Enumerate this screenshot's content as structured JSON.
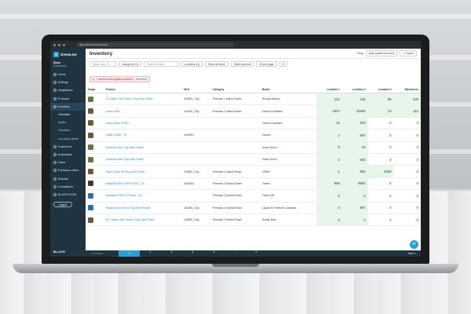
{
  "browser": {
    "url": "app.blaze.me/inventory"
  },
  "sidebar": {
    "brand": "GreenLine",
    "store_name": "Store",
    "store_sub": "Downtown",
    "items": [
      {
        "label": "Home",
        "icon": "home-icon"
      },
      {
        "label": "Settings",
        "icon": "gear-icon"
      },
      {
        "label": "Integrations",
        "icon": "plug-icon"
      },
      {
        "label": "Products",
        "icon": "box-icon"
      },
      {
        "label": "Inventory",
        "icon": "boxes-icon"
      }
    ],
    "subitems": [
      "Overview",
      "Audits",
      "Transfers",
      "Low stock alerts"
    ],
    "items2": [
      {
        "label": "Customers",
        "icon": "users-icon"
      },
      {
        "label": "Employees",
        "icon": "badge-icon"
      },
      {
        "label": "Sales",
        "icon": "cart-icon"
      },
      {
        "label": "Purchase orders",
        "icon": "clipboard-icon"
      },
      {
        "label": "Reports",
        "icon": "chart-icon"
      },
      {
        "label": "Compliance",
        "icon": "shield-icon"
      },
      {
        "label": "BLAZE ECOM",
        "icon": "globe-icon"
      }
    ],
    "logout": "Logout",
    "footer": "BLAZE"
  },
  "header": {
    "title": "Inventory",
    "help": "Help",
    "bulk": "Bulk update live stock",
    "export": "Export"
  },
  "filters": {
    "search_placeholder": "Name, sku, ID",
    "categories": "Categories (1)",
    "brand_placeholder": "Select a brand",
    "locations": "Locations (4)",
    "stock": "Show all stock",
    "columns": "Table columns",
    "per_page": "20 per page"
  },
  "alert": {
    "text": "1 product with negative inventory",
    "link": "View them"
  },
  "table": {
    "headers": [
      "Image",
      "Product",
      "SKU",
      "Category",
      "Brand",
      "Location 1",
      "Location 2",
      "Location 3",
      "Warehouse"
    ],
    "rows": [
      {
        "product": "22 Jupiter Gold Fusion 3.5g Dried Flower",
        "sku": "102823_3.5g",
        "category": "Premium 1 Indica Flower",
        "brand": "Woody Harvest",
        "l1": "121",
        "l2": "145",
        "l3": "99",
        "wh": "100",
        "thumb": "green"
      },
      {
        "product": "Ammo Haze",
        "sku": "101619_3.5g",
        "category": "Premium 2 Indica Flower",
        "brand": "Carmel Cannabis",
        "l1": "2047",
        "l2": "10094",
        "l3": "13",
        "wh": "112",
        "thumb": ""
      },
      {
        "product": "Ammo Haze 3.5 BO",
        "sku": "",
        "category": "",
        "brand": "Carmel Cannabis",
        "l1": "10",
        "l2": "975",
        "l3": "0",
        "wh": "0",
        "thumb": ""
      },
      {
        "product": "AMMO HAZE - 10",
        "sku": "1000941",
        "category": "",
        "brand": "Carmel",
        "l1": "2",
        "l2": "997",
        "l3": "0",
        "wh": "0",
        "thumb": ""
      },
      {
        "product": "Amnesia Haze 3.5g Dried Flower",
        "sku": "",
        "category": "",
        "brand": "Home Kit Inc.",
        "l1": "0",
        "l2": "20",
        "l3": "0",
        "wh": "0",
        "thumb": "green"
      },
      {
        "product": "Amnesia Haze 3.5g Dried Flower",
        "sku": "",
        "category": "",
        "brand": "Home Kit Inc.",
        "l1": "0",
        "l2": "940",
        "l3": "0",
        "wh": "0",
        "thumb": "green"
      },
      {
        "product": "Bacio Punch #9 3.5g Dried Flower",
        "sku": "103891_3.5g",
        "category": "Premium 2 Indica Flower",
        "brand": "OGEN",
        "l1": "1",
        "l2": "882",
        "l3": "1000",
        "wh": "0",
        "thumb": ""
      },
      {
        "product": "BANANA PRETZAPP KUSH - 3.5",
        "sku": "1000344",
        "category": "Premium 2 Hybrid Flower",
        "brand": "Tweed",
        "l1": "996",
        "l2": "9950",
        "l3": "0",
        "wh": "0",
        "thumb": "dark"
      },
      {
        "product": "Barbados PURPLE Punch - 3.5",
        "sku": "",
        "category": "Premium 2 Hybrid Flower",
        "brand": "Flower SE",
        "l1": "0",
        "l2": "0",
        "l3": "0",
        "wh": "0",
        "thumb": "blue"
      },
      {
        "product": "Banana Kush Punch 3.5g Dried Flower",
        "sku": "102294_3.5g",
        "category": "Premium 2 Hybrid Flower",
        "brand": "Lloyds St. Premium Cannabis",
        "l1": "0",
        "l2": "997",
        "l3": "0",
        "wh": "0",
        "thumb": "blue"
      },
      {
        "product": "BC Organic Blue Dream 3.5g Dried Flower",
        "sku": "103892_3.5g",
        "category": "Premium 2 Hybrid Flower",
        "brand": "Simply Bare",
        "l1": "0",
        "l2": "0",
        "l3": "0",
        "wh": "0",
        "thumb": ""
      }
    ]
  },
  "pager": {
    "prev": "< Previous",
    "pages": [
      "1",
      "2",
      "3",
      "4",
      "5",
      "...",
      "9"
    ],
    "active": "1",
    "next": "Next >"
  }
}
